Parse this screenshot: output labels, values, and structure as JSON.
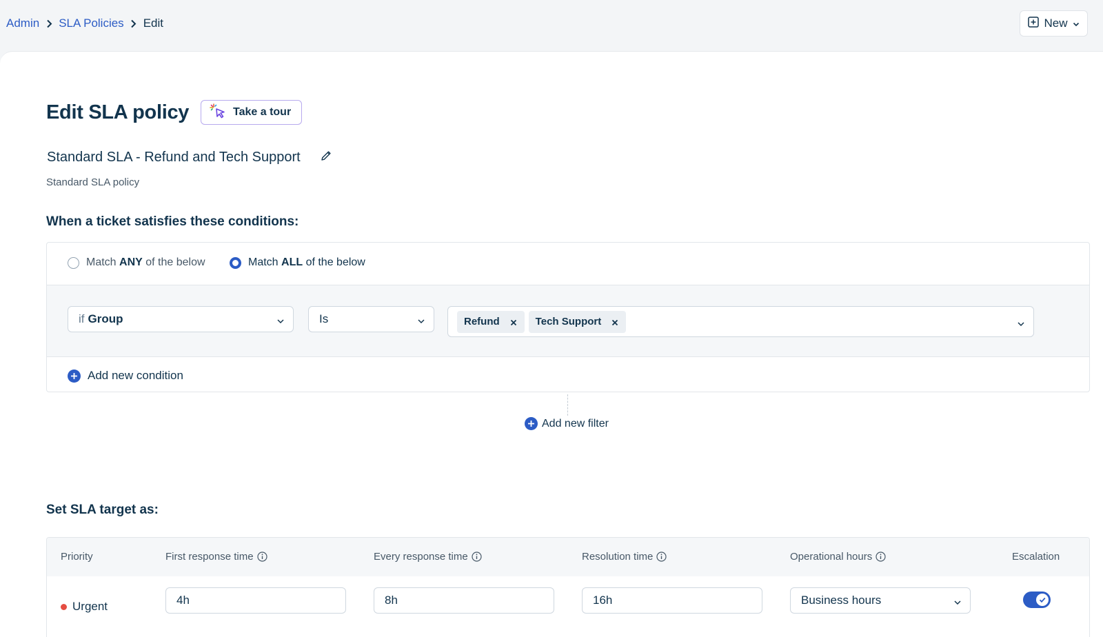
{
  "breadcrumb": {
    "items": [
      "Admin",
      "SLA Policies"
    ],
    "current": "Edit"
  },
  "header": {
    "new_label": "New"
  },
  "page": {
    "title": "Edit SLA policy",
    "tour_label": "Take a tour",
    "policy_name": "Standard SLA - Refund and Tech Support",
    "policy_description": "Standard SLA policy"
  },
  "conditions": {
    "heading": "When a ticket satisfies these conditions:",
    "match_any": {
      "prefix": "Match ",
      "keyword": "ANY",
      "suffix": " of the below",
      "selected": false
    },
    "match_all": {
      "prefix": "Match ",
      "keyword": "ALL",
      "suffix": " of the below",
      "selected": true
    },
    "rule": {
      "field_prefix": "if",
      "field": "Group",
      "operator": "Is",
      "values": [
        "Refund",
        "Tech Support"
      ]
    },
    "add_condition_label": "Add new condition",
    "add_filter_label": "Add new filter"
  },
  "sla_target": {
    "heading": "Set SLA target as:",
    "columns": {
      "priority": "Priority",
      "first_response": "First response time",
      "every_response": "Every response time",
      "resolution": "Resolution time",
      "operational_hours": "Operational hours",
      "escalation": "Escalation"
    },
    "rows": [
      {
        "priority": "Urgent",
        "first_response": "4h",
        "every_response": "8h",
        "resolution": "16h",
        "operational_hours": "Business hours",
        "escalation": true
      }
    ]
  },
  "colors": {
    "accent": "#2c5cc5",
    "urgent": "#e54d42",
    "text": "#12344d"
  }
}
